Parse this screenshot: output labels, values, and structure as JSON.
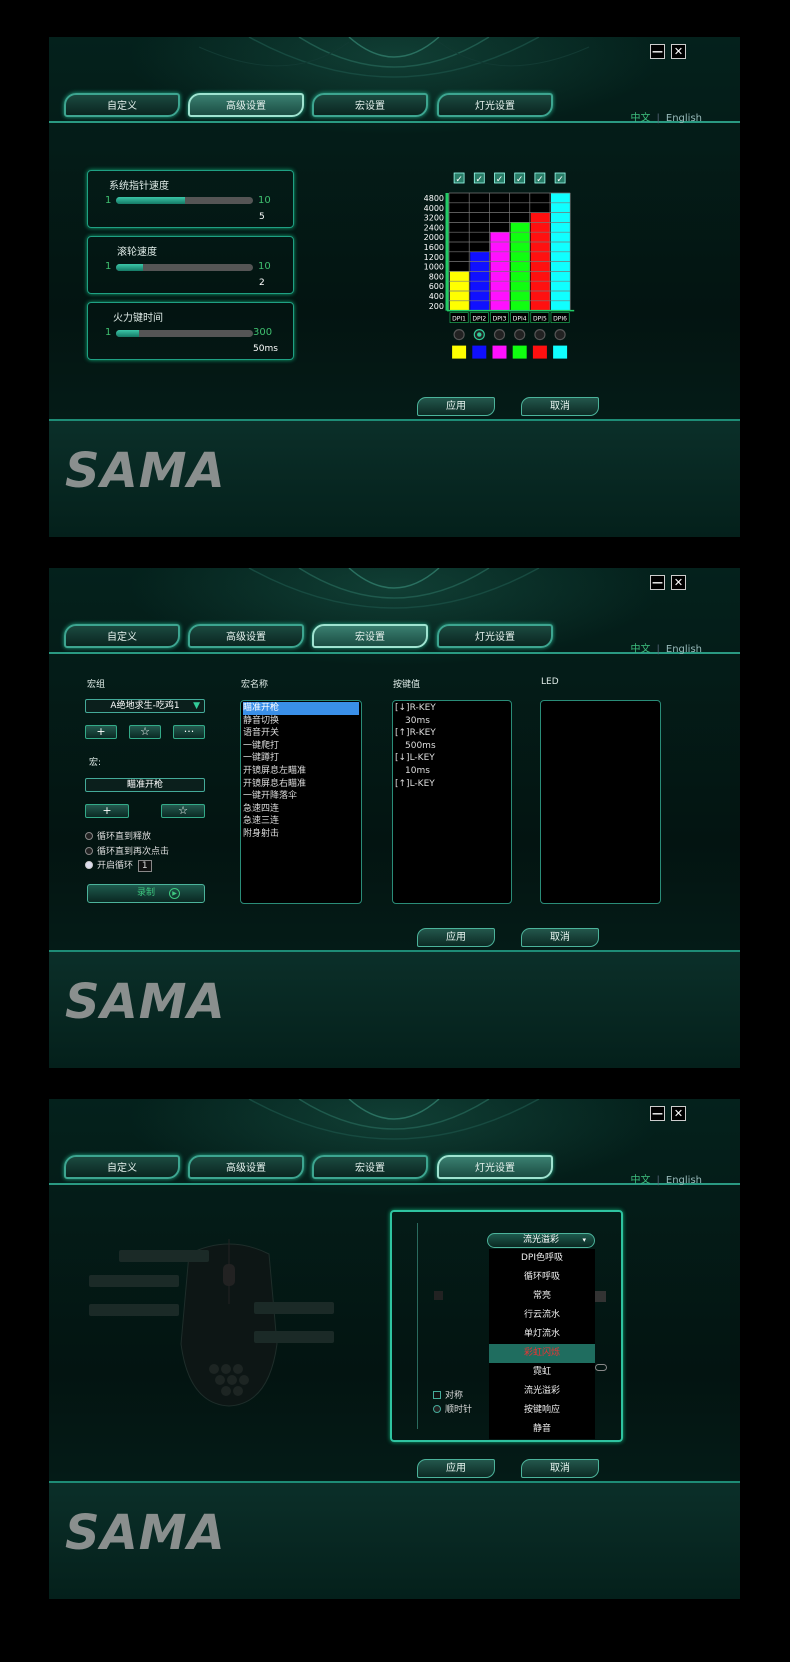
{
  "window": {
    "minimize_label": "—",
    "close_label": "✕"
  },
  "tabs": [
    "自定义",
    "高级设置",
    "宏设置",
    "灯光设置"
  ],
  "lang": {
    "cn": "中文",
    "sep": "|",
    "en": "English"
  },
  "brand": "SAMA",
  "actions": {
    "apply": "应用",
    "cancel": "取消"
  },
  "advanced": {
    "pointer": {
      "label": "系统指针速度",
      "min": "1",
      "max": "10",
      "value": "5",
      "fraction": 0.5
    },
    "wheel": {
      "label": "滚轮速度",
      "min": "1",
      "max": "10",
      "value": "2",
      "fraction": 0.2
    },
    "fire": {
      "label": "火力键时间",
      "min": "1",
      "max": "300",
      "value": "50ms",
      "fraction": 0.17
    }
  },
  "chart_data": {
    "type": "bar",
    "categories": [
      "DPI1",
      "DPI2",
      "DPI3",
      "DPI4",
      "DPI5",
      "DPI6"
    ],
    "yticks": [
      "4800",
      "4000",
      "3200",
      "2400",
      "2000",
      "1600",
      "1200",
      "1000",
      "800",
      "600",
      "400",
      "200"
    ],
    "values_tick_index": [
      4,
      6,
      8,
      9,
      10,
      12
    ],
    "colors": [
      "#ffff00",
      "#1010ff",
      "#ff10ff",
      "#10ff10",
      "#ff1010",
      "#10ffff"
    ],
    "checked": [
      true,
      true,
      true,
      true,
      true,
      true
    ],
    "selected_index": 1,
    "check_mark": "✓"
  },
  "macro": {
    "group_label": "宏组",
    "group_value": "A绝地求生-吃鸡1",
    "group_buttons": [
      "+",
      "☆",
      "···"
    ],
    "macro_label": "宏:",
    "macro_value": "瞄准开枪",
    "macro_buttons": [
      "+",
      "☆"
    ],
    "options": [
      "循环直到释放",
      "循环直到再次点击",
      "开启循环"
    ],
    "loop_count": "1",
    "record_label": "录制",
    "names_header": "宏名称",
    "names": [
      "瞄准开枪",
      "静音切换",
      "语音开关",
      "一键爬打",
      "一键蹲打",
      "开镜屏息左瞄准",
      "开镜屏息右瞄准",
      "一键开降落伞",
      "急速四连",
      "急速三连",
      "附身射击"
    ],
    "keys_header": "按键值",
    "keys": [
      "[↓]R-KEY",
      "30ms",
      "[↑]R-KEY",
      "500ms",
      "[↓]L-KEY",
      "10ms",
      "[↑]L-KEY"
    ],
    "led_header": "LED"
  },
  "lighting": {
    "dropdown_value": "流光溢彩",
    "effects": [
      "DPI色呼吸",
      "循环呼吸",
      "常亮",
      "行云流水",
      "单灯流水",
      "彩虹闪烁",
      "霓虹",
      "流光溢彩",
      "按键响应",
      "静音"
    ],
    "highlighted_index": 5,
    "symmetric_label": "对称",
    "clockwise_label": "顺时针"
  }
}
